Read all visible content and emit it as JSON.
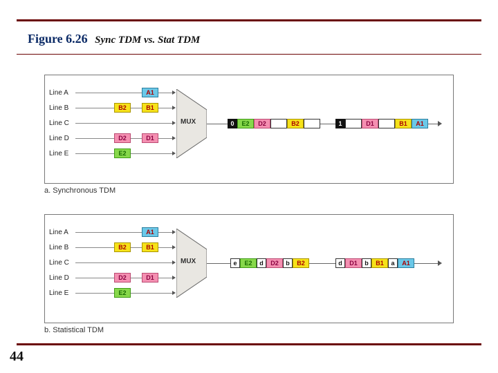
{
  "figure": {
    "number": "Figure 6.26",
    "title": "Sync TDM vs. Stat TDM"
  },
  "page_number": "44",
  "lines": {
    "A": "Line A",
    "B": "Line B",
    "C": "Line C",
    "D": "Line D",
    "E": "Line E"
  },
  "mux_label": "MUX",
  "slots": {
    "A1": "A1",
    "B1": "B1",
    "B2": "B2",
    "D1": "D1",
    "D2": "D2",
    "E2": "E2",
    "flag0": "0",
    "flag1": "1",
    "a_tag": "a",
    "b_tag": "b",
    "d_tag": "d",
    "e_tag": "e"
  },
  "captions": {
    "a": "a. Synchronous TDM",
    "b": "b. Statistical TDM"
  }
}
